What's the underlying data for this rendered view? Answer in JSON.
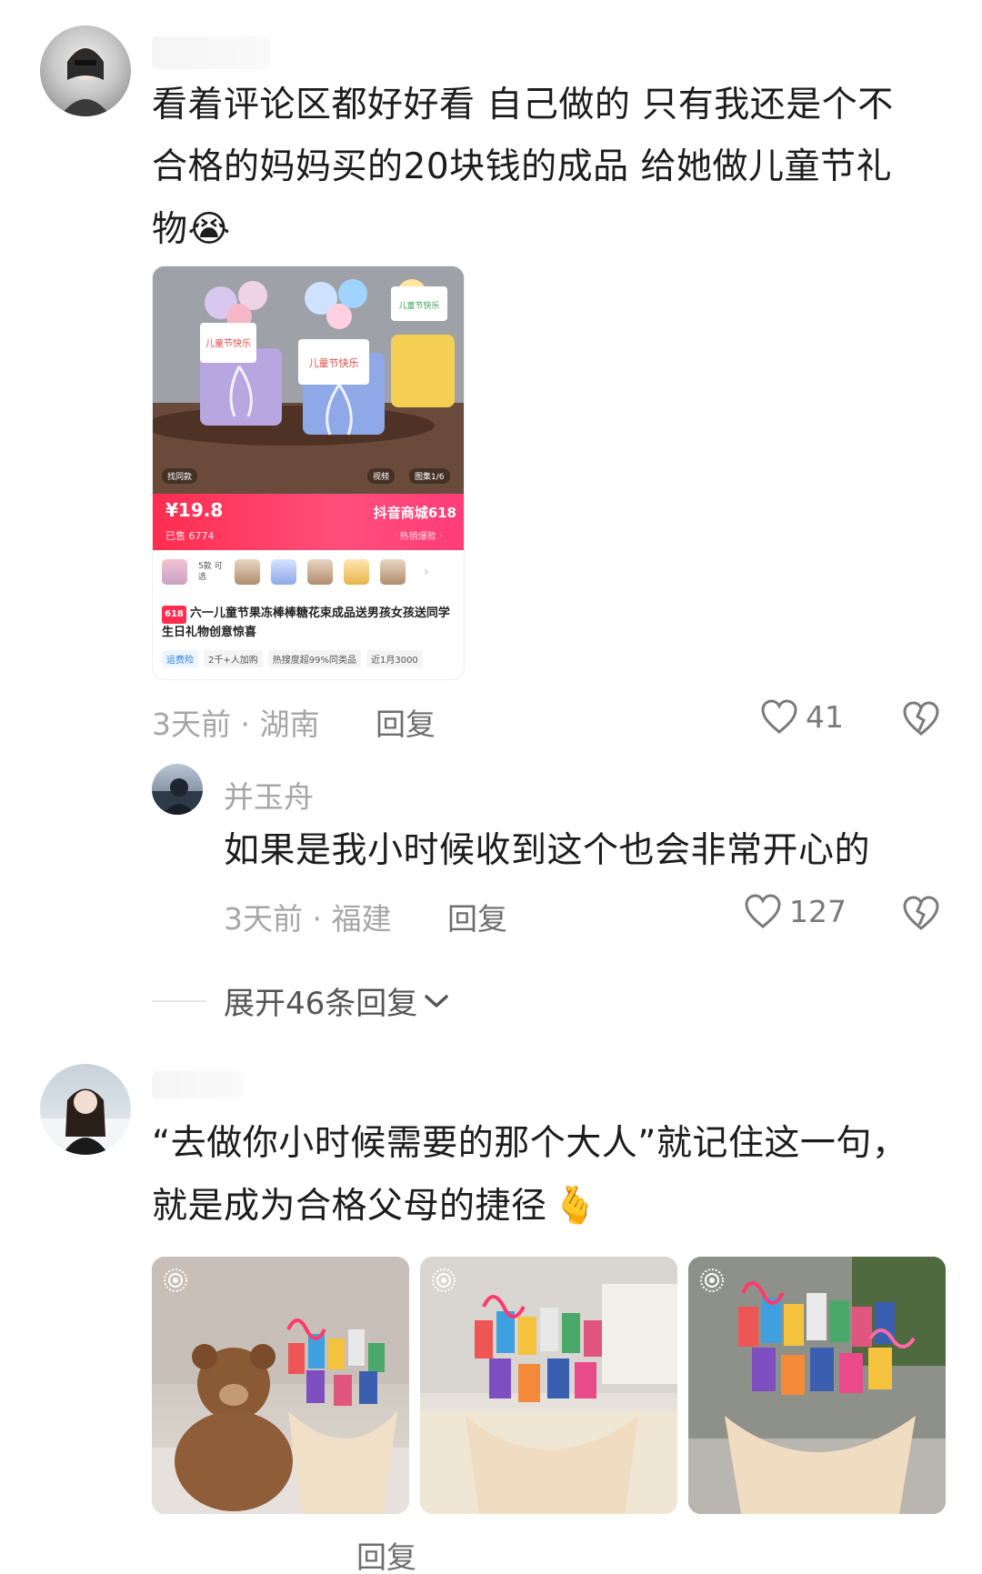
{
  "comment1": {
    "text_lines": [
      "看着评论区都好好看 自己做的 只有我还是个不",
      "合格的妈妈买的20块钱的成品 给她做儿童节礼",
      "物"
    ],
    "emoji": "😭",
    "time_location": "3天前 · 湖南",
    "reply_label": "回复",
    "likes": "41",
    "product": {
      "price": "¥19.8",
      "sold": "已售 6774",
      "mall": "抖音商城618",
      "hot": "· 热销爆款 ·",
      "variant_label": "5款 可选",
      "badge": "618",
      "title": "六一儿童节果冻棒棒糖花束成品送男孩女孩送同学生日礼物创意惊喜",
      "tags": [
        "运费险",
        "2千+人加购",
        "热搜度超99%同类品",
        "近1月3000"
      ],
      "overlay_left": "找同款",
      "overlay_video": "视频",
      "overlay_gallery": "图集1/6",
      "photo_sign": "HAPPY 儿童节快乐"
    }
  },
  "reply1": {
    "username": "并玉舟",
    "text": "如果是我小时候收到这个也会非常开心的",
    "time_location": "3天前 · 福建",
    "reply_label": "回复",
    "likes": "127"
  },
  "expand_label": "展开46条回复",
  "comment2": {
    "text_lines": [
      "“去做你小时候需要的那个大人”就记住这一句，",
      "就是成为合格父母的捷径"
    ],
    "emoji": "🫰",
    "reply_label": "回复"
  },
  "colors": {
    "text": "#1c1c1c",
    "meta": "#a6a6a6",
    "price_bar": "#ff2d4f"
  },
  "icons": [
    "heart-outline-icon",
    "broken-heart-icon",
    "chevron-down-icon",
    "live-photo-icon"
  ]
}
